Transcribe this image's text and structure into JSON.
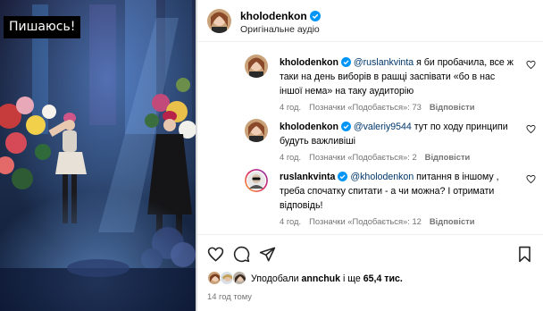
{
  "media": {
    "caption": "Пишаюсь!"
  },
  "header": {
    "username": "kholodenkon",
    "audio": "Оригінальне аудіо"
  },
  "comments": [
    {
      "username": "kholodenkon",
      "mention": "@ruslankvinta",
      "text": " я би пробачила, все ж таки на день виборів в рашці заспівати «бо в нас іншої нема» на таку аудиторію",
      "time": "4 год.",
      "liked_by": "Позначки «Подобається»: 73",
      "reply": "Відповісти"
    },
    {
      "username": "kholodenkon",
      "mention": "@valeriy9544",
      "text": " тут по ходу принципи будуть важливіші",
      "time": "4 год.",
      "liked_by": "Позначки «Подобається»: 2",
      "reply": "Відповісти"
    },
    {
      "username": "ruslankvinta",
      "mention": "@kholodenkon",
      "text": " питання в іншому , треба спочатку спитати - а чи можна? І отримати відповідь!",
      "time": "4 год.",
      "liked_by": "Позначки «Подобається»: 12",
      "reply": "Відповісти"
    }
  ],
  "likes": {
    "prefix": "Уподобали ",
    "user": "annchuk",
    "middle": " і ще ",
    "count": "65,4 тис."
  },
  "post_time": "14 год тому",
  "colors": {
    "verified": "#0095f6",
    "mention": "#00376b",
    "meta": "#737373"
  },
  "icons": [
    "verified-badge-icon",
    "heart-icon",
    "comment-icon",
    "share-icon",
    "bookmark-icon"
  ]
}
